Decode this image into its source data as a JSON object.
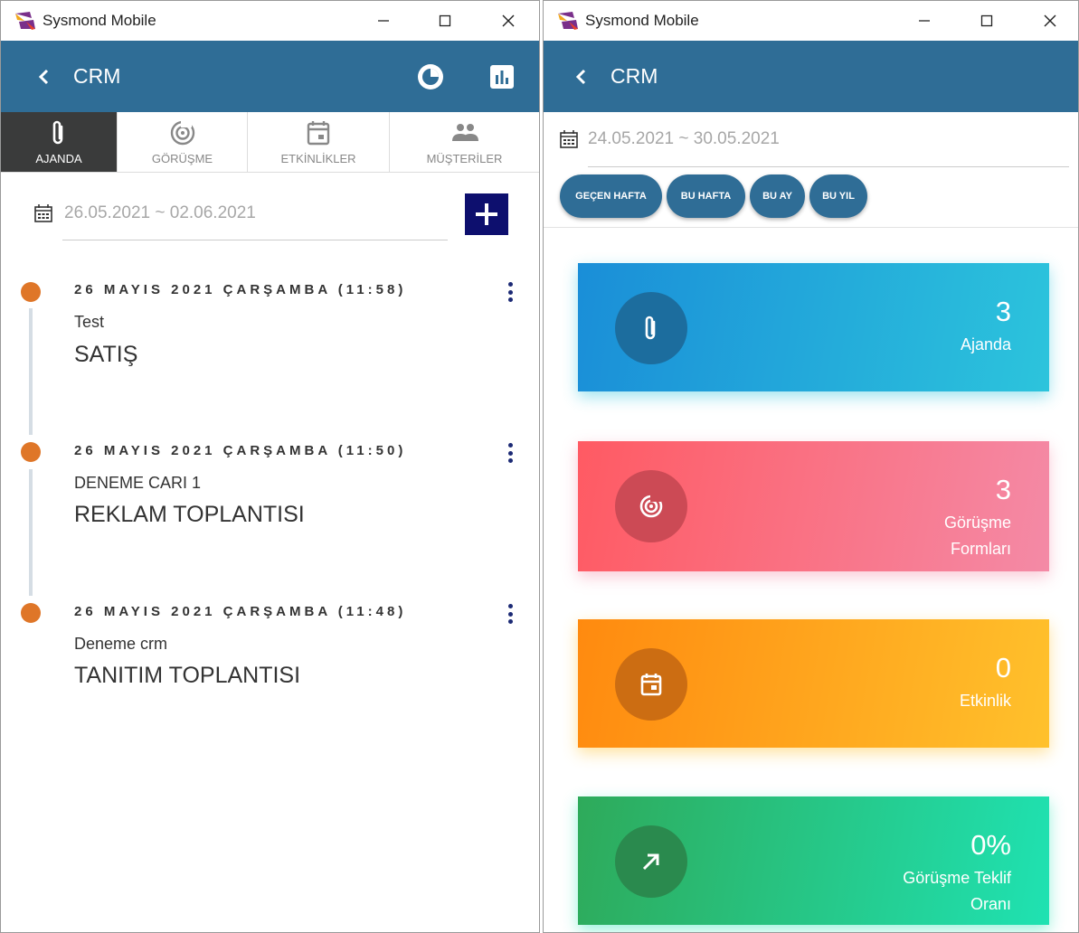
{
  "left_window": {
    "title": "Sysmond Mobile",
    "appbar_title": "CRM",
    "tabs": [
      {
        "label": "AJANDA",
        "icon": "paperclip-icon",
        "active": true
      },
      {
        "label": "GÖRÜŞME",
        "icon": "target-icon",
        "active": false
      },
      {
        "label": "ETKİNLİKLER",
        "icon": "calendar-icon",
        "active": false
      },
      {
        "label": "MÜŞTERİLER",
        "icon": "people-icon",
        "active": false
      }
    ],
    "date_range": "26.05.2021 ~ 02.06.2021",
    "entries": [
      {
        "date": "26 MAYIS 2021 ÇARŞAMBA (11:58)",
        "subtitle": "Test",
        "title": "SATIŞ"
      },
      {
        "date": "26 MAYIS 2021 ÇARŞAMBA (11:50)",
        "subtitle": "DENEME CARI 1",
        "title": "REKLAM TOPLANTISI"
      },
      {
        "date": "26 MAYIS 2021 ÇARŞAMBA (11:48)",
        "subtitle": "Deneme crm",
        "title": "TANITIM TOPLANTISI"
      }
    ]
  },
  "right_window": {
    "title": "Sysmond Mobile",
    "appbar_title": "CRM",
    "date_range": "24.05.2021 ~ 30.05.2021",
    "filters": [
      "GEÇEN HAFTA",
      "BU HAFTA",
      "BU AY",
      "BU YIL"
    ],
    "cards": [
      {
        "value": "3",
        "label_lines": [
          "Ajanda"
        ],
        "icon": "paperclip-icon",
        "colors": [
          "#1a8ed8",
          "#2cc4dc"
        ]
      },
      {
        "value": "3",
        "label_lines": [
          "Görüşme",
          "Formları"
        ],
        "icon": "target-icon",
        "colors": [
          "#ff5a63",
          "#f48aa6"
        ]
      },
      {
        "value": "0",
        "label_lines": [
          "Etkinlik"
        ],
        "icon": "calendar-icon",
        "colors": [
          "#ff8a0f",
          "#ffc12c"
        ]
      },
      {
        "value": "0%",
        "label_lines": [
          "Görüşme Teklif",
          "Oranı"
        ],
        "icon": "arrow-up-right-icon",
        "colors": [
          "#2eaa5a",
          "#1fe2b2"
        ]
      }
    ]
  },
  "colors": {
    "appbar": "#2f6d96",
    "accent_dot": "#df7628",
    "add_button": "#0d0f6e"
  }
}
